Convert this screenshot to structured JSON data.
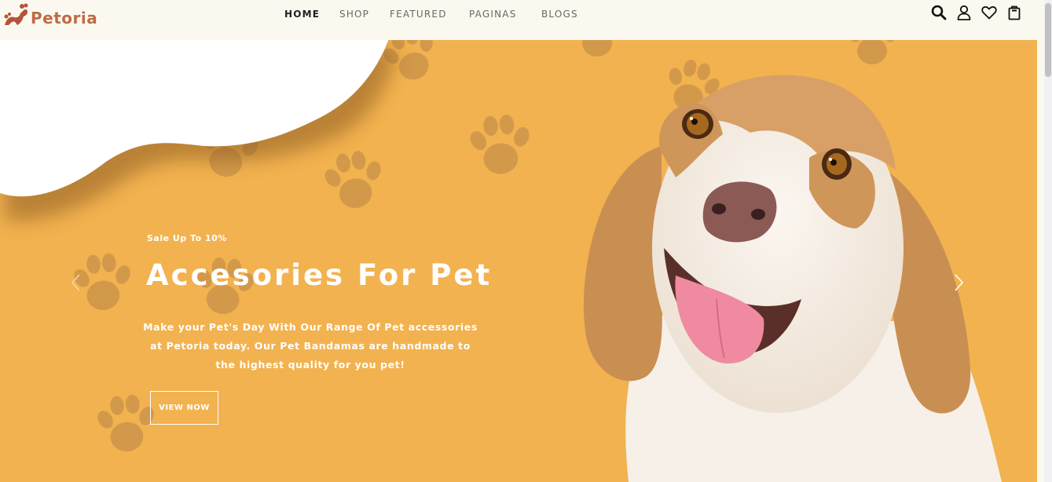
{
  "brand": {
    "name": "Petoria",
    "color": "#c06b45"
  },
  "nav": {
    "items": [
      {
        "label": "HOME",
        "active": true
      },
      {
        "label": "SHOP",
        "active": false
      },
      {
        "label": "FEATURED",
        "active": false
      },
      {
        "label": "PAGINAS",
        "active": false
      },
      {
        "label": "BLOGS",
        "active": false
      }
    ]
  },
  "header_icons": [
    "search-icon",
    "user-icon",
    "heart-icon",
    "cart-icon"
  ],
  "hero": {
    "background_color": "#f2b24f",
    "sale_text": "Sale Up To 10%",
    "title": "Accesories For Pet",
    "description": "Make your Pet's Day With Our Range Of Pet accessories at Petoria today. Our Pet Bandamas are handmade to the highest quality for you pet!",
    "button_label": "VIEW NOW",
    "prev_icon": "chevron-left-icon",
    "next_icon": "chevron-right-icon"
  }
}
